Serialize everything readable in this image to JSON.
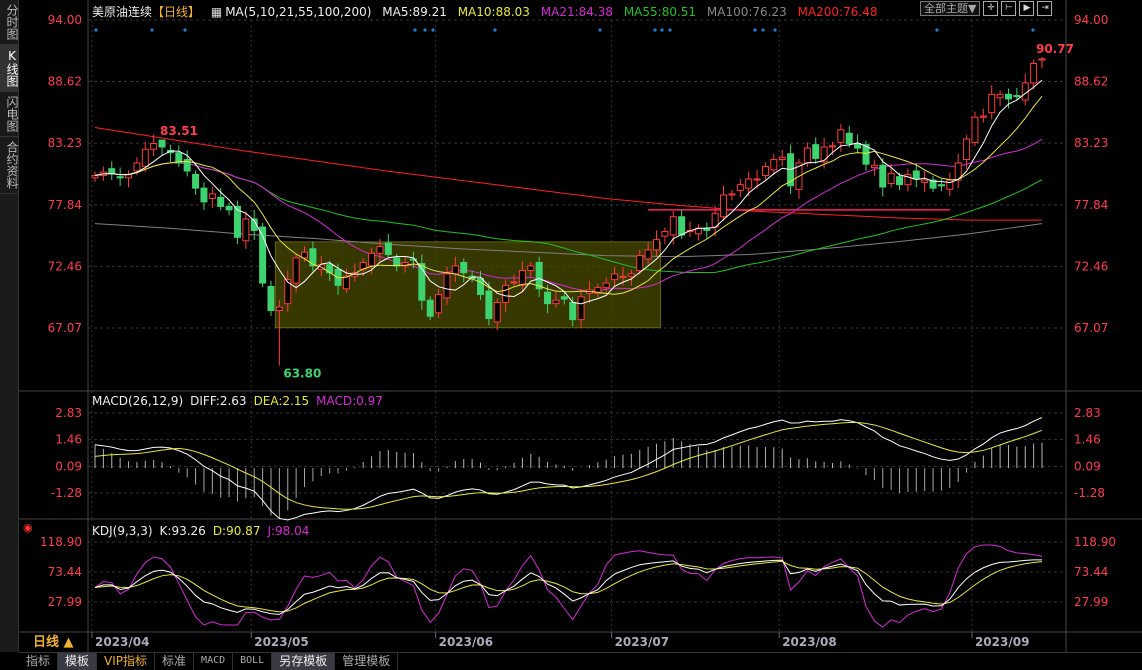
{
  "sidebar": {
    "tabs": [
      "分时图",
      "K线图",
      "闪电图",
      "合约资料"
    ],
    "selected": 1
  },
  "header": {
    "instrument": "美原油连续",
    "period_tag": "【日线】",
    "ma_label": "MA(5,10,21,55,100,200)",
    "ma5": "MA5:89.21",
    "ma10": "MA10:88.03",
    "ma21": "MA21:84.38",
    "ma55": "MA55:80.51",
    "ma100": "MA100:76.23",
    "ma200": "MA200:76.48",
    "theme_button": "全部主题▼"
  },
  "macd_header": {
    "label": "MACD(26,12,9)",
    "diff": "DIFF:2.63",
    "dea": "DEA:2.15",
    "macd": "MACD:0.97"
  },
  "kdj_header": {
    "label": "KDJ(9,3,3)",
    "k": "K:93.26",
    "d": "D:90.87",
    "j": "J:98.04"
  },
  "period_button": "日线 ▲",
  "bottom_tabs": [
    "指标",
    "模板",
    "VIP指标",
    "标准",
    "MACD",
    "BOLL",
    "另存模板",
    "管理模板"
  ],
  "colors": {
    "up": "#ff3b3b",
    "down": "#3dd36f",
    "ma5": "#ffffff",
    "ma10": "#e8e83a",
    "ma21": "#d52ad5",
    "ma55": "#22c022",
    "ma100": "#808080",
    "ma200": "#ff2020",
    "axis": "#ff3b4e"
  },
  "chart_data": {
    "type": "candlestick",
    "price_axis": {
      "ticks": [
        "94.00",
        "88.62",
        "83.23",
        "77.84",
        "72.46",
        "67.07"
      ],
      "range": [
        61.5,
        95.2
      ]
    },
    "macd_axis": {
      "ticks": [
        "2.83",
        "1.46",
        "0.09",
        "-1.28"
      ]
    },
    "kdj_axis": {
      "ticks": [
        "118.90",
        "73.44",
        "27.99"
      ]
    },
    "date_labels": [
      {
        "label": "2023/04",
        "index": 0
      },
      {
        "label": "2023/05",
        "index": 19
      },
      {
        "label": "2023/06",
        "index": 41
      },
      {
        "label": "2023/07",
        "index": 62
      },
      {
        "label": "2023/08",
        "index": 82
      },
      {
        "label": "2023/09",
        "index": 105
      }
    ],
    "close": [
      80.4,
      80.7,
      80.6,
      80.2,
      80.5,
      81.5,
      82.7,
      83.2,
      82.9,
      82.4,
      81.5,
      80.8,
      79.3,
      78.1,
      78.8,
      77.7,
      77.4,
      75.0,
      76.6,
      75.6,
      71.0,
      68.6,
      68.9,
      71.3,
      73.2,
      73.7,
      72.5,
      72.6,
      71.9,
      70.8,
      71.6,
      71.9,
      72.8,
      73.6,
      74.2,
      73.5,
      72.5,
      72.8,
      73.0,
      69.5,
      68.1,
      70.0,
      71.8,
      72.5,
      71.9,
      71.4,
      70.0,
      67.9,
      69.3,
      70.8,
      71.1,
      72.1,
      72.5,
      70.5,
      69.2,
      69.5,
      69.6,
      67.8,
      69.8,
      70.4,
      70.6,
      71.0,
      71.8,
      71.6,
      71.8,
      73.4,
      73.9,
      74.8,
      75.5,
      76.8,
      75.2,
      75.6,
      75.8,
      75.6,
      77.1,
      78.7,
      78.8,
      79.6,
      80.1,
      80.1,
      81.2,
      81.8,
      82.0,
      79.5,
      81.5,
      82.8,
      81.9,
      82.9,
      83.0,
      84.4,
      83.2,
      82.8,
      81.4,
      81.3,
      79.4,
      80.6,
      79.6,
      80.5,
      80.1,
      80.0,
      79.3,
      79.5,
      80.0,
      81.5,
      83.6,
      85.5,
      85.6,
      87.5,
      87.5,
      87.1,
      87.3,
      88.5,
      90.2,
      90.6
    ],
    "ma100": [
      76.2,
      75.8,
      75.3,
      74.9,
      74.4,
      74.0,
      73.7,
      73.4,
      73.3,
      73.5,
      74.0,
      74.6,
      75.3,
      76.2
    ],
    "ma200": [
      84.6,
      83.6,
      82.6,
      81.7,
      80.8,
      80.0,
      79.2,
      78.4,
      77.8,
      77.3,
      77.0,
      76.7,
      76.5,
      76.5
    ],
    "annotations": {
      "high": "83.51",
      "high_index": 8,
      "low": "63.80",
      "low_index": 22,
      "last_high": "90.77"
    },
    "box": {
      "from_index": 22,
      "to_index": 67,
      "top": 74.6,
      "bottom": 67.1
    },
    "hline": {
      "price": 77.4,
      "from_index": 66,
      "to_index": 102
    }
  }
}
